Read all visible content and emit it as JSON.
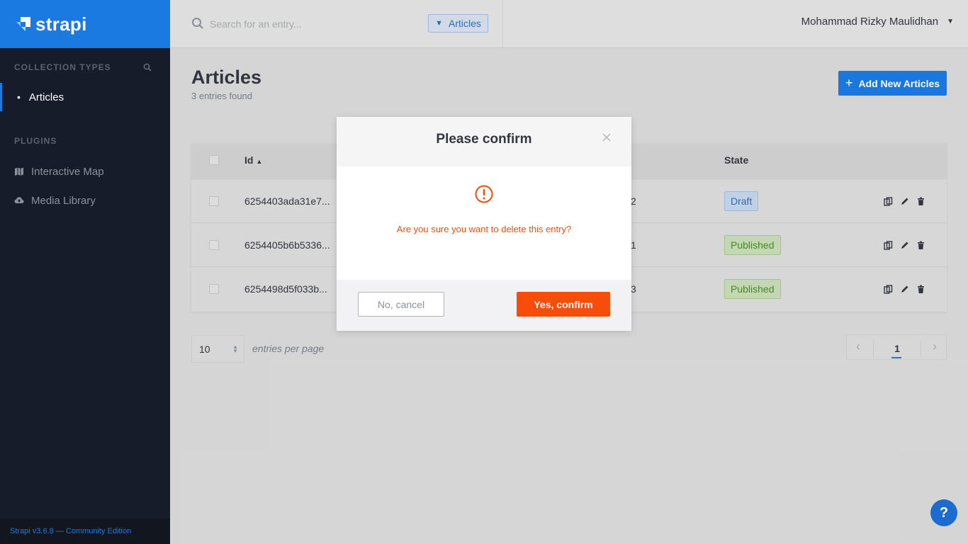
{
  "sidebar": {
    "brand": "strapi",
    "collection_types_title": "COLLECTION TYPES",
    "collection_items": [
      {
        "label": "Articles"
      }
    ],
    "plugins_title": "PLUGINS",
    "plugin_items": [
      {
        "label": "Interactive Map"
      },
      {
        "label": "Media Library"
      }
    ],
    "footer": "Strapi v3.6.8 — Community Edition"
  },
  "topbar": {
    "search_placeholder": "Search for an entry...",
    "filter_label": "Articles",
    "user_name": "Mohammad Rizky Maulidhan"
  },
  "main": {
    "title": "Articles",
    "subtitle": "3 entries found",
    "add_button": "Add New Articles",
    "columns": {
      "id": "Id",
      "state": "State"
    },
    "rows": [
      {
        "id": "6254403ada31e7...",
        "partial": "2",
        "state": "Draft"
      },
      {
        "id": "6254405b6b5336...",
        "partial": "1",
        "state": "Published"
      },
      {
        "id": "6254498d5f033b...",
        "partial": "3",
        "state": "Published"
      }
    ],
    "per_page_value": "10",
    "per_page_label": "entries per page",
    "current_page": "1"
  },
  "modal": {
    "title": "Please confirm",
    "message": "Are you sure you want to delete this entry?",
    "cancel": "No, cancel",
    "confirm": "Yes, confirm"
  },
  "help": "?",
  "colors": {
    "accent": "#1b7ae2",
    "danger": "#f64d0a",
    "sidebar": "#161c29"
  }
}
